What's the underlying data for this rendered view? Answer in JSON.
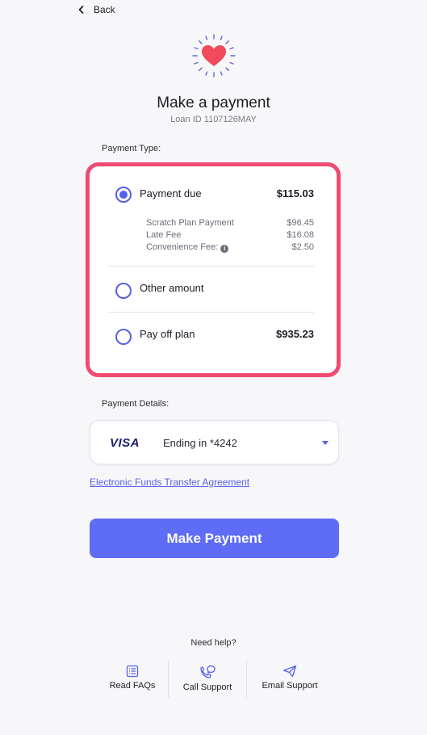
{
  "nav": {
    "back_label": "Back"
  },
  "header": {
    "title": "Make a payment",
    "loan_id": "Loan ID 1107126MAY"
  },
  "payment_type": {
    "label": "Payment Type:",
    "options": [
      {
        "label": "Payment due",
        "amount": "$115.03",
        "selected": true,
        "breakdown": [
          {
            "label": "Scratch Plan Payment",
            "value": "$96.45"
          },
          {
            "label": "Late Fee",
            "value": "$16.08"
          },
          {
            "label": "Convenience Fee:",
            "value": "$2.50"
          }
        ]
      },
      {
        "label": "Other amount",
        "amount": "",
        "selected": false
      },
      {
        "label": "Pay off plan",
        "amount": "$935.23",
        "selected": false
      }
    ]
  },
  "payment_details": {
    "label": "Payment Details:",
    "card_brand": "VISA",
    "card_ending": "Ending in *4242"
  },
  "agreement_link": "Electronic Funds Transfer Agreement",
  "submit_label": "Make Payment",
  "help": {
    "title": "Need help?",
    "items": [
      {
        "label": "Read FAQs",
        "icon": "faq-list-icon"
      },
      {
        "label": "Call Support",
        "icon": "phone-chat-icon"
      },
      {
        "label": "Email Support",
        "icon": "paper-plane-icon"
      }
    ]
  },
  "colors": {
    "accent": "#5f6cf5",
    "highlight_border": "#ef4a72",
    "heart": "#f04a5c"
  }
}
